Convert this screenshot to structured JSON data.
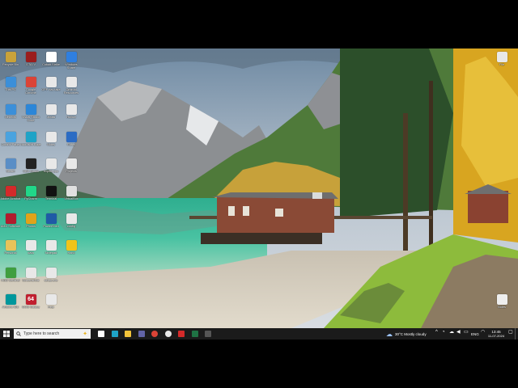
{
  "desktop": {
    "icons": [
      {
        "col": 0,
        "row": 0,
        "label": "Recycle Bin",
        "glyph": "",
        "color": "#c9a23a"
      },
      {
        "col": 1,
        "row": 0,
        "label": "GTA IV",
        "glyph": "",
        "color": "#9a1d1d"
      },
      {
        "col": 2,
        "row": 0,
        "label": "Cobalt Strike",
        "glyph": "A",
        "color": "#ffffff"
      },
      {
        "col": 3,
        "row": 0,
        "label": "Windows Share",
        "glyph": "",
        "color": "#2f7fe0"
      },
      {
        "col": 0,
        "row": 1,
        "label": "This PC",
        "glyph": "",
        "color": "#3b8fd9"
      },
      {
        "col": 1,
        "row": 1,
        "label": "Google Chrome",
        "glyph": "",
        "color": "#db4437"
      },
      {
        "col": 2,
        "row": 1,
        "label": "CPP nav take",
        "glyph": "",
        "color": "#e8e8e8"
      },
      {
        "col": 3,
        "row": 1,
        "label": "Optimal Resources",
        "glyph": "",
        "color": "#e8e8e8"
      },
      {
        "col": 0,
        "row": 2,
        "label": "Network",
        "glyph": "",
        "color": "#3b8fd9"
      },
      {
        "col": 1,
        "row": 2,
        "label": "Visual Studio Code",
        "glyph": "",
        "color": "#2b86d8"
      },
      {
        "col": 2,
        "row": 2,
        "label": "Jlouisi",
        "glyph": "",
        "color": "#e8e8e8"
      },
      {
        "col": 3,
        "row": 2,
        "label": "Hollow",
        "glyph": "",
        "color": "#e8e8e8"
      },
      {
        "col": 0,
        "row": 3,
        "label": "Control Panel",
        "glyph": "",
        "color": "#4aa3df"
      },
      {
        "col": 1,
        "row": 3,
        "label": "Microsoft Edge",
        "glyph": "",
        "color": "#1fa3c7"
      },
      {
        "col": 2,
        "row": 3,
        "label": "Notes",
        "glyph": "",
        "color": "#e8e8e8"
      },
      {
        "col": 3,
        "row": 3,
        "label": "Rufus",
        "glyph": "",
        "color": "#2b6cc4"
      },
      {
        "col": 0,
        "row": 4,
        "label": "Steam",
        "glyph": "",
        "color": "#5a8ec6"
      },
      {
        "col": 1,
        "row": 4,
        "label": "OBS Studio",
        "glyph": "",
        "color": "#222222"
      },
      {
        "col": 2,
        "row": 4,
        "label": "exploit.cpp",
        "glyph": "",
        "color": "#e8e8e8"
      },
      {
        "col": 3,
        "row": 4,
        "label": "Projects",
        "glyph": "",
        "color": "#e8e8e8"
      },
      {
        "col": 0,
        "row": 5,
        "label": "Adobe Acrobat",
        "glyph": "",
        "color": "#d42a2a"
      },
      {
        "col": 1,
        "row": 5,
        "label": "PyCharm",
        "glyph": "",
        "color": "#21d789"
      },
      {
        "col": 2,
        "row": 5,
        "label": "Terminal",
        "glyph": "",
        "color": "#111111"
      },
      {
        "col": 3,
        "row": 5,
        "label": "VirtualBox",
        "glyph": "",
        "color": "#e0e0e0"
      },
      {
        "col": 0,
        "row": 6,
        "label": "AMD Software",
        "glyph": "",
        "color": "#b01c2e"
      },
      {
        "col": 1,
        "row": 6,
        "label": "Photos",
        "glyph": "",
        "color": "#e0a31a"
      },
      {
        "col": 2,
        "row": 6,
        "label": "PowerShell",
        "glyph": "",
        "color": "#1f5aa6"
      },
      {
        "col": 3,
        "row": 6,
        "label": "config",
        "glyph": "",
        "color": "#e8e8e8"
      },
      {
        "col": 0,
        "row": 7,
        "label": "Personal",
        "glyph": "",
        "color": "#e8c35a"
      },
      {
        "col": 1,
        "row": 7,
        "label": "data",
        "glyph": "",
        "color": "#e8e8e8"
      },
      {
        "col": 2,
        "row": 7,
        "label": "Notepad",
        "glyph": "",
        "color": "#e8e8e8"
      },
      {
        "col": 3,
        "row": 7,
        "label": "Hand",
        "glyph": "",
        "color": "#f0c419"
      },
      {
        "col": 0,
        "row": 8,
        "label": "HDD Sentinel",
        "glyph": "",
        "color": "#3f9f3f"
      },
      {
        "col": 1,
        "row": 8,
        "label": "Screenshots",
        "glyph": "",
        "color": "#e8e8e8"
      },
      {
        "col": 2,
        "row": 8,
        "label": "setup.exe",
        "glyph": "",
        "color": "#e8e8e8"
      },
      {
        "col": 0,
        "row": 9,
        "label": "Arduino IDE",
        "glyph": "",
        "color": "#00979c"
      },
      {
        "col": 1,
        "row": 9,
        "label": "GOG Galaxy",
        "glyph": "64",
        "color": "#c01f2f"
      },
      {
        "col": 2,
        "row": 9,
        "label": "Help",
        "glyph": "",
        "color": "#e8e8e8"
      }
    ],
    "right_icons": [
      {
        "label": "File",
        "color": "#e8e8e8"
      },
      {
        "label": "Notes",
        "color": "#eeeeee"
      }
    ]
  },
  "taskbar": {
    "search_placeholder": "Type here to search",
    "pinned": [
      {
        "name": "task-view",
        "color": "#ffffff"
      },
      {
        "name": "edge",
        "color": "#1fa3c7"
      },
      {
        "name": "file-explorer",
        "color": "#f3c33a"
      },
      {
        "name": "teams",
        "color": "#6264a7"
      },
      {
        "name": "chrome-red",
        "color": "#db4437"
      },
      {
        "name": "chrome",
        "color": "#e8e8e8"
      },
      {
        "name": "acrobat",
        "color": "#d42a2a"
      },
      {
        "name": "excel",
        "color": "#1f7244"
      },
      {
        "name": "terminal",
        "color": "#555555"
      }
    ],
    "weather": "30°C  Mostly cloudy",
    "language": "ENG",
    "time": "13:45",
    "date": "11-07-2024"
  }
}
